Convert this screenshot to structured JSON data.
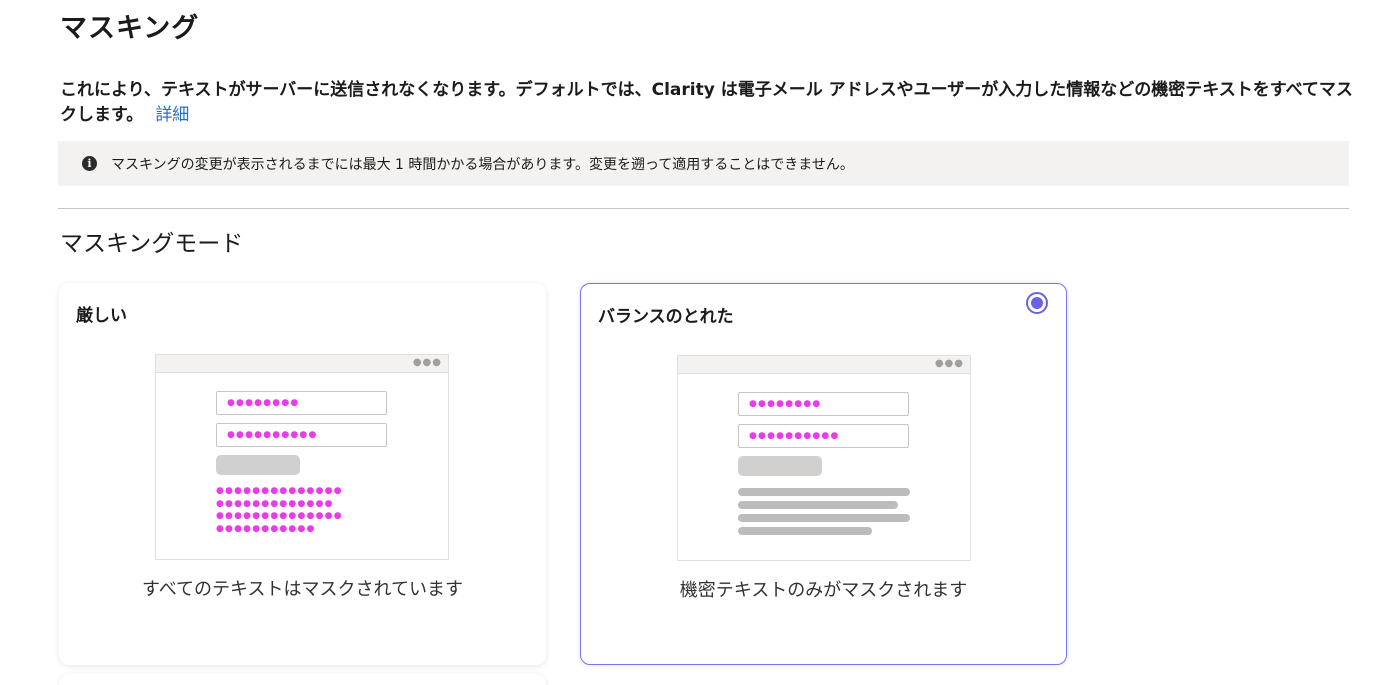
{
  "page": {
    "title": "マスキング",
    "description": "これにより、テキストがサーバーに送信されなくなります。デフォルトでは、Clarity は電子メール アドレスやユーザーが入力した情報などの機密テキストをすべてマスクします。",
    "learn_more_link": "詳細",
    "notice": "マスキングの変更が表示されるまでには最大 1 時間かかる場合があります。変更を遡って適用することはできません。",
    "section_title": "マスキングモード"
  },
  "modes": [
    {
      "title": "厳しい",
      "caption": "すべてのテキストはマスクされています",
      "selected": false
    },
    {
      "title": "バランスのとれた",
      "caption": "機密テキストのみがマスクされます",
      "selected": true
    }
  ],
  "illustration": {
    "window_dots": "●●●",
    "field1_mask": "●●●●●●●●",
    "field2_mask": "●●●●●●●●●●",
    "text_mask": "●●●●●●●●●●●●●●\n●●●●●●●●●●●●●\n●●●●●●●●●●●●●●\n●●●●●●●●●●●"
  },
  "colors": {
    "accent": "#6b62e8",
    "link": "#1f6fd0",
    "mask": "#e83ce8"
  }
}
